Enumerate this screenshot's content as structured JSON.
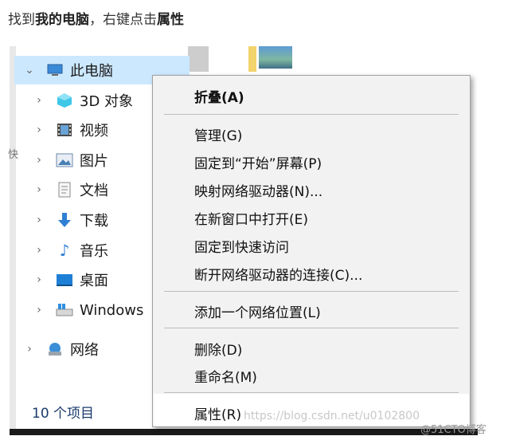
{
  "caption": {
    "prefix": "找到",
    "bold1": "我的电脑",
    "middle": "，右键点击",
    "bold2": "属性"
  },
  "explorer": {
    "side_letter": "快",
    "tree": [
      {
        "label": "此电脑",
        "icon": "computer-icon",
        "expanded": true,
        "selected": true
      },
      {
        "label": "3D 对象",
        "icon": "3d-objects-icon"
      },
      {
        "label": "视频",
        "icon": "video-icon"
      },
      {
        "label": "图片",
        "icon": "pictures-icon"
      },
      {
        "label": "文档",
        "icon": "documents-icon"
      },
      {
        "label": "下载",
        "icon": "downloads-icon"
      },
      {
        "label": "音乐",
        "icon": "music-icon"
      },
      {
        "label": "桌面",
        "icon": "desktop-icon"
      },
      {
        "label": "Windows",
        "icon": "windows-drive-icon"
      },
      {
        "label": "网络",
        "icon": "network-icon"
      }
    ],
    "status": "10 个项目"
  },
  "context_menu": {
    "items": [
      {
        "label": "折叠(A)",
        "bold": true
      },
      {
        "label": "管理(G)"
      },
      {
        "label": "固定到“开始”屏幕(P)"
      },
      {
        "label": "映射网络驱动器(N)..."
      },
      {
        "label": "在新窗口中打开(E)"
      },
      {
        "label": "固定到快速访问"
      },
      {
        "label": "断开网络驱动器的连接(C)..."
      },
      {
        "label": "添加一个网络位置(L)"
      },
      {
        "label": "删除(D)"
      },
      {
        "label": "重命名(M)"
      },
      {
        "label": "属性(R)"
      }
    ]
  },
  "watermark": "https://blog.csdn.net/u0102800",
  "watermark_credit": "@51CTO博客"
}
